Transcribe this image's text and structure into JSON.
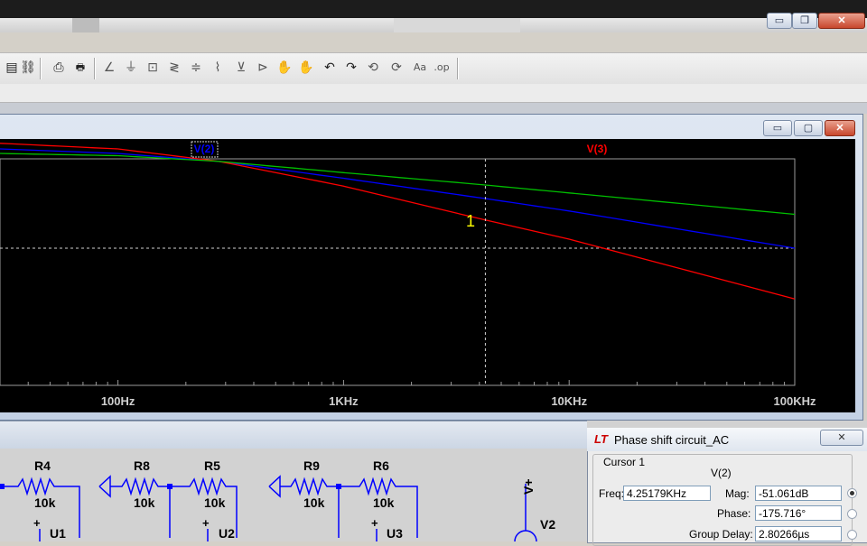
{
  "app": {
    "top_buttons": {
      "minimize": "▭",
      "restore": "❐",
      "close": "✕"
    }
  },
  "toolbar": {
    "icons": [
      "clipboard-icon",
      "find-icon",
      "print-preview-icon",
      "print-icon",
      "wire-icon",
      "ground-icon",
      "label-net-icon",
      "resistor-icon",
      "capacitor-icon",
      "inductor-icon",
      "diode-icon",
      "component-icon",
      "move-icon",
      "drag-icon",
      "undo-icon",
      "redo-icon",
      "rotate-icon",
      "mirror-icon",
      "text-icon",
      "spice-directive-icon"
    ],
    "glyphs": [
      "▤",
      "⛓",
      "⎙",
      "🖶",
      "∠",
      "⏚",
      "⊡",
      "≷",
      "≑",
      "⌇",
      "⊻",
      "⊳",
      "✋",
      "✋",
      "↶",
      "↷",
      "⟲",
      "⟳",
      "Aa",
      ".op"
    ]
  },
  "plot_window": {
    "buttons": {
      "minimize": "▭",
      "restore": "▢",
      "close": "✕"
    },
    "trace_labels": [
      {
        "name": "V(2)",
        "color": "#0000ff"
      },
      {
        "name": "V(3)",
        "color": "#ff0000"
      }
    ],
    "cursor_marker": "1"
  },
  "chart_data": {
    "type": "line",
    "xscale": "log",
    "xlim": [
      30,
      100000
    ],
    "x_ticks": [
      "100Hz",
      "1KHz",
      "10KHz",
      "100KHz"
    ],
    "grid": "off",
    "cursor": {
      "freq_hz": 4251.79,
      "label": "1"
    },
    "series": [
      {
        "name": "V(2)",
        "color": "#0000ff",
        "x": [
          30,
          100,
          280,
          1000,
          4251.79,
          10000,
          100000
        ],
        "y": [
          0.88,
          0.84,
          0.77,
          0.62,
          0.44,
          0.33,
          0.0
        ]
      },
      {
        "name": "V(3)",
        "color": "#ff0000",
        "x": [
          30,
          100,
          280,
          1000,
          4251.79,
          10000,
          100000
        ],
        "y": [
          0.93,
          0.88,
          0.77,
          0.55,
          0.25,
          0.08,
          -0.45
        ]
      },
      {
        "color": "#00c000",
        "x": [
          30,
          100,
          280,
          1000,
          4251.79,
          10000,
          100000
        ],
        "y": [
          0.84,
          0.82,
          0.77,
          0.67,
          0.56,
          0.49,
          0.3
        ]
      }
    ]
  },
  "schematic": {
    "parts": [
      {
        "ref": "R4",
        "value": "10k"
      },
      {
        "ref": "R8",
        "value": "10k"
      },
      {
        "ref": "R5",
        "value": "10k"
      },
      {
        "ref": "R9",
        "value": "10k"
      },
      {
        "ref": "R6",
        "value": "10k"
      }
    ],
    "opamps": [
      "U1",
      "U2",
      "U3"
    ],
    "source": "V2",
    "supply_label": "V+"
  },
  "cursor_dialog": {
    "logo": "LT",
    "title": "Phase shift circuit_AC",
    "close": "✕",
    "group_label": "Cursor 1",
    "trace": "V(2)",
    "freq_label": "Freq:",
    "freq_value": "4.25179KHz",
    "mag_label": "Mag:",
    "mag_value": "-51.061dB",
    "phase_label": "Phase:",
    "phase_value": "-175.716°",
    "delay_label": "Group Delay:",
    "delay_value": "2.80266µs"
  }
}
